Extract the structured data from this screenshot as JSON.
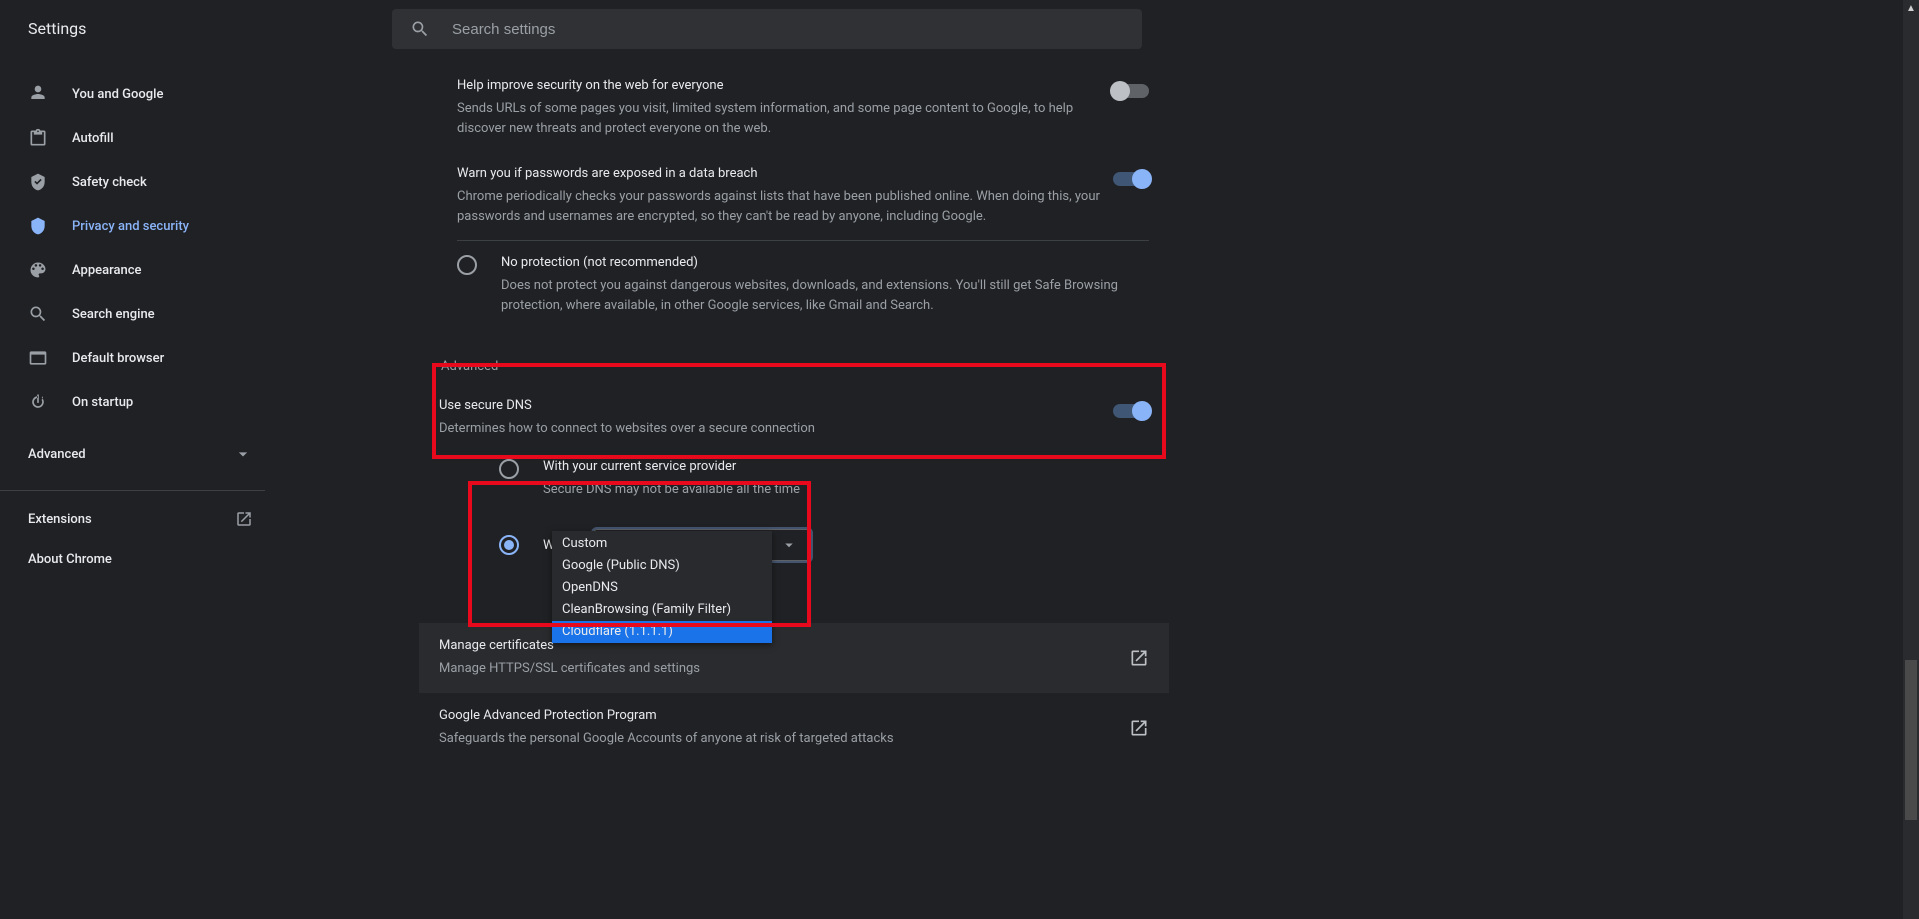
{
  "header": {
    "title": "Settings",
    "search_placeholder": "Search settings"
  },
  "sidebar": {
    "items": [
      {
        "label": "You and Google"
      },
      {
        "label": "Autofill"
      },
      {
        "label": "Safety check"
      },
      {
        "label": "Privacy and security"
      },
      {
        "label": "Appearance"
      },
      {
        "label": "Search engine"
      },
      {
        "label": "Default browser"
      },
      {
        "label": "On startup"
      }
    ],
    "advanced_label": "Advanced",
    "extensions_label": "Extensions",
    "about_label": "About Chrome"
  },
  "content": {
    "help_improve": {
      "title": "Help improve security on the web for everyone",
      "desc": "Sends URLs of some pages you visit, limited system information, and some page content to Google, to help discover new threats and protect everyone on the web.",
      "checked": false
    },
    "warn_breach": {
      "title": "Warn you if passwords are exposed in a data breach",
      "desc": "Chrome periodically checks your passwords against lists that have been published online. When doing this, your passwords and usernames are encrypted, so they can't be read by anyone, including Google.",
      "checked": true
    },
    "no_protection": {
      "title": "No protection (not recommended)",
      "desc": "Does not protect you against dangerous websites, downloads, and extensions. You'll still get Safe Browsing protection, where available, in other Google services, like Gmail and Search."
    },
    "advanced_section": "Advanced",
    "secure_dns": {
      "title": "Use secure DNS",
      "desc": "Determines how to connect to websites over a secure connection",
      "checked": true,
      "current_provider": {
        "label": "With your current service provider",
        "desc": "Secure DNS may not be available all the time"
      },
      "with_label": "With",
      "selected": "Cloudflare (1.1.1.1)",
      "options": [
        "Custom",
        "Google (Public DNS)",
        "OpenDNS",
        "CleanBrowsing (Family Filter)",
        "Cloudflare (1.1.1.1)"
      ],
      "highlighted_option_index": 4
    },
    "manage_certs": {
      "title": "Manage certificates",
      "desc": "Manage HTTPS/SSL certificates and settings"
    },
    "gapp": {
      "title": "Google Advanced Protection Program",
      "desc": "Safeguards the personal Google Accounts of anyone at risk of targeted attacks"
    }
  }
}
